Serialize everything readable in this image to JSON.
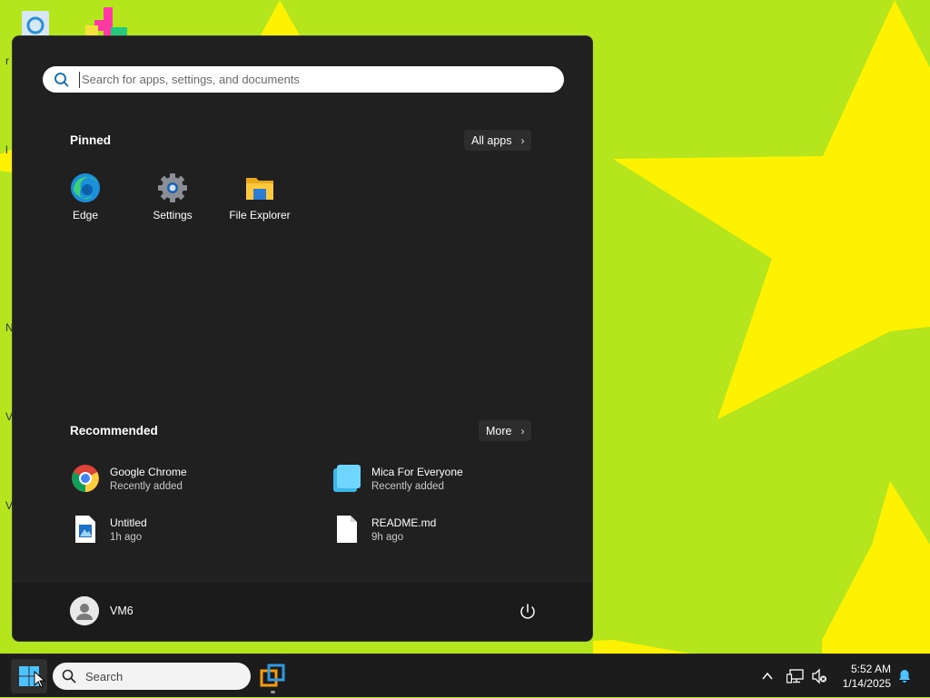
{
  "start_menu": {
    "search_placeholder": "Search for apps, settings, and documents",
    "pinned_title": "Pinned",
    "all_apps_label": "All apps",
    "pinned_apps": [
      {
        "label": "Edge",
        "icon": "edge-icon"
      },
      {
        "label": "Settings",
        "icon": "settings-gear-icon"
      },
      {
        "label": "File Explorer",
        "icon": "folder-icon"
      }
    ],
    "recommended_title": "Recommended",
    "more_label": "More",
    "recommended": [
      {
        "name": "Google Chrome",
        "sub": "Recently added",
        "icon": "chrome-icon"
      },
      {
        "name": "Mica For Everyone",
        "sub": "Recently added",
        "icon": "mica-icon"
      },
      {
        "name": "Untitled",
        "sub": "1h ago",
        "icon": "image-file-icon"
      },
      {
        "name": "README.md",
        "sub": "9h ago",
        "icon": "document-icon"
      }
    ],
    "user_name": "VM6"
  },
  "taskbar": {
    "search_label": "Search",
    "clock_time": "5:52 AM",
    "clock_date": "1/14/2025"
  },
  "colors": {
    "wallpaper_green": "#b5e61d",
    "wallpaper_star": "#fff200",
    "menu_bg": "#202020",
    "accent": "#4cc2ff"
  }
}
